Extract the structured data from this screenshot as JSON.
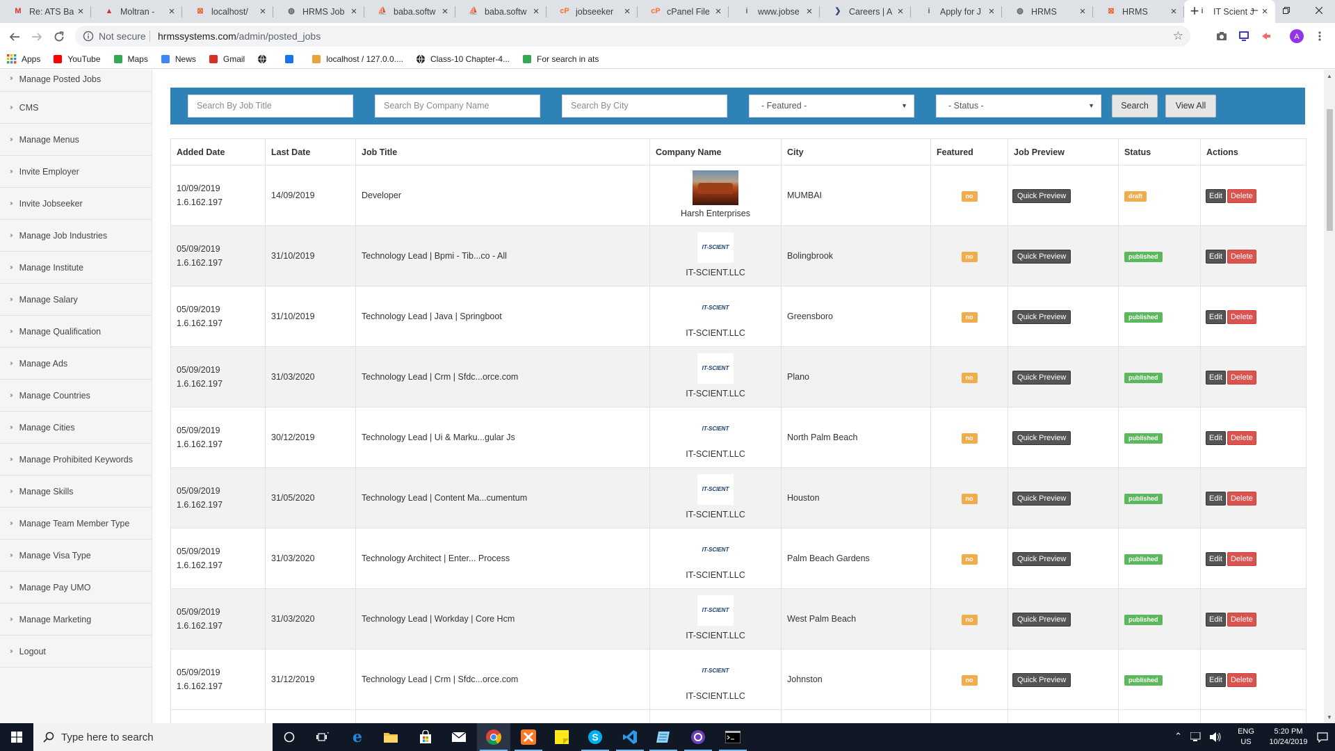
{
  "browser": {
    "tabs": [
      {
        "label": "Re: ATS Ba",
        "icon": "gmail-icon",
        "color": "#d93025",
        "glyph": "M"
      },
      {
        "label": "Moltran -",
        "icon": "moltran-icon",
        "color": "#d0343e",
        "glyph": "▲"
      },
      {
        "label": "localhost/",
        "icon": "xampp-icon",
        "color": "#e8622c",
        "glyph": "⊠"
      },
      {
        "label": "HRMS Job",
        "icon": "globe-icon",
        "color": "#5f6368",
        "glyph": "◍"
      },
      {
        "label": "baba.softw",
        "icon": "phpmyadmin-icon",
        "color": "#e8a33c",
        "glyph": "⛵"
      },
      {
        "label": "baba.softw",
        "icon": "phpmyadmin-icon",
        "color": "#e8a33c",
        "glyph": "⛵"
      },
      {
        "label": "jobseeker",
        "icon": "cpanel-icon",
        "color": "#ff6c2c",
        "glyph": "cP"
      },
      {
        "label": "cPanel File",
        "icon": "cpanel-icon",
        "color": "#ff6c2c",
        "glyph": "cP"
      },
      {
        "label": "www.jobse",
        "icon": "info-icon",
        "color": "#5f6368",
        "glyph": "i"
      },
      {
        "label": "Careers | A",
        "icon": "careers-icon",
        "color": "#2d4a7a",
        "glyph": "❯"
      },
      {
        "label": "Apply for J",
        "icon": "info-icon",
        "color": "#5f6368",
        "glyph": "i"
      },
      {
        "label": "HRMS",
        "icon": "globe-icon",
        "color": "#5f6368",
        "glyph": "◍"
      },
      {
        "label": "HRMS",
        "icon": "xampp-icon",
        "color": "#e8622c",
        "glyph": "⊠"
      },
      {
        "label": "IT Scient J",
        "icon": "info-icon",
        "color": "#5f6368",
        "glyph": "i",
        "active": true
      }
    ],
    "address": {
      "security": "Not secure",
      "host": "hrmssystems.com",
      "path": "/admin/posted_jobs"
    },
    "bookmarks": [
      {
        "label": "Apps",
        "icon": "apps-grid-icon",
        "color": "#d93025"
      },
      {
        "label": "YouTube",
        "icon": "youtube-icon",
        "color": "#ff0000"
      },
      {
        "label": "Maps",
        "icon": "maps-icon",
        "color": "#34a853"
      },
      {
        "label": "News",
        "icon": "news-icon",
        "color": "#4285f4"
      },
      {
        "label": "Gmail",
        "icon": "gmail-icon",
        "color": "#d93025"
      },
      {
        "label": "",
        "icon": "globe-icon",
        "color": "#202124"
      },
      {
        "label": "",
        "icon": "image-icon",
        "color": "#1a73e8"
      },
      {
        "label": "localhost / 127.0.0....",
        "icon": "phpmyadmin-icon",
        "color": "#e8a33c"
      },
      {
        "label": "Class-10 Chapter-4...",
        "icon": "globe-icon",
        "color": "#202124"
      },
      {
        "label": "For search in ats",
        "icon": "sheet-icon",
        "color": "#34a853"
      }
    ]
  },
  "sidebar": {
    "items": [
      "Manage Posted Jobs",
      "CMS",
      "Manage Menus",
      "Invite Employer",
      "Invite Jobseeker",
      "Manage Job Industries",
      "Manage Institute",
      "Manage Salary",
      "Manage Qualification",
      "Manage Ads",
      "Manage Countries",
      "Manage Cities",
      "Manage Prohibited Keywords",
      "Manage Skills",
      "Manage Team Member Type",
      "Manage Visa Type",
      "Manage Pay UMO",
      "Manage Marketing",
      "Logout"
    ]
  },
  "search": {
    "job_title_placeholder": "Search By Job Title",
    "company_placeholder": "Search By Company Name",
    "city_placeholder": "Search By City",
    "featured_selected": "- Featured -",
    "status_selected": "- Status -",
    "search_label": "Search",
    "view_all_label": "View All"
  },
  "table": {
    "headers": [
      "Added Date",
      "Last Date",
      "Job Title",
      "Company Name",
      "City",
      "Featured",
      "Job Preview",
      "Status",
      "Actions"
    ],
    "quick_preview_label": "Quick Preview",
    "edit_label": "Edit",
    "delete_label": "Delete",
    "logo_text": "IT-SCIENT",
    "rows": [
      {
        "added": "10/09/2019",
        "ip": "1.6.162.197",
        "last": "14/09/2019",
        "title": "Developer",
        "company": "Harsh Enterprises",
        "logo": "photo",
        "city": "MUMBAI",
        "featured": "no",
        "status": "draft"
      },
      {
        "added": "05/09/2019",
        "ip": "1.6.162.197",
        "last": "31/10/2019",
        "title": "Technology Lead | Bpmi - Tib...co - All",
        "company": "IT-SCIENT.LLC",
        "logo": "it",
        "city": "Bolingbrook",
        "featured": "no",
        "status": "published"
      },
      {
        "added": "05/09/2019",
        "ip": "1.6.162.197",
        "last": "31/10/2019",
        "title": "Technology Lead | Java | Springboot",
        "company": "IT-SCIENT.LLC",
        "logo": "it",
        "city": "Greensboro",
        "featured": "no",
        "status": "published"
      },
      {
        "added": "05/09/2019",
        "ip": "1.6.162.197",
        "last": "31/03/2020",
        "title": "Technology Lead | Crm | Sfdc...orce.com",
        "company": "IT-SCIENT.LLC",
        "logo": "it",
        "city": "Plano",
        "featured": "no",
        "status": "published"
      },
      {
        "added": "05/09/2019",
        "ip": "1.6.162.197",
        "last": "30/12/2019",
        "title": "Technology Lead | Ui & Marku...gular Js",
        "company": "IT-SCIENT.LLC",
        "logo": "it",
        "city": "North Palm Beach",
        "featured": "no",
        "status": "published"
      },
      {
        "added": "05/09/2019",
        "ip": "1.6.162.197",
        "last": "31/05/2020",
        "title": "Technology Lead | Content Ma...cumentum",
        "company": "IT-SCIENT.LLC",
        "logo": "it",
        "city": "Houston",
        "featured": "no",
        "status": "published"
      },
      {
        "added": "05/09/2019",
        "ip": "1.6.162.197",
        "last": "31/03/2020",
        "title": "Technology Architect | Enter... Process",
        "company": "IT-SCIENT.LLC",
        "logo": "it",
        "city": "Palm Beach Gardens",
        "featured": "no",
        "status": "published"
      },
      {
        "added": "05/09/2019",
        "ip": "1.6.162.197",
        "last": "31/03/2020",
        "title": "Technology Lead | Workday | Core Hcm",
        "company": "IT-SCIENT.LLC",
        "logo": "it",
        "city": "West Palm Beach",
        "featured": "no",
        "status": "published"
      },
      {
        "added": "05/09/2019",
        "ip": "1.6.162.197",
        "last": "31/12/2019",
        "title": "Technology Lead | Crm | Sfdc...orce.com",
        "company": "IT-SCIENT.LLC",
        "logo": "it",
        "city": "Johnston",
        "featured": "no",
        "status": "published"
      }
    ]
  },
  "taskbar": {
    "search_placeholder": "Type here to search",
    "lang": "ENG",
    "region": "US",
    "time": "5:20 PM",
    "date": "10/24/2019"
  },
  "colors": {
    "search_bar": "#2f82b6",
    "badge_no": "#f0ad4e",
    "badge_published": "#5cb85c",
    "delete": "#d9534f"
  }
}
